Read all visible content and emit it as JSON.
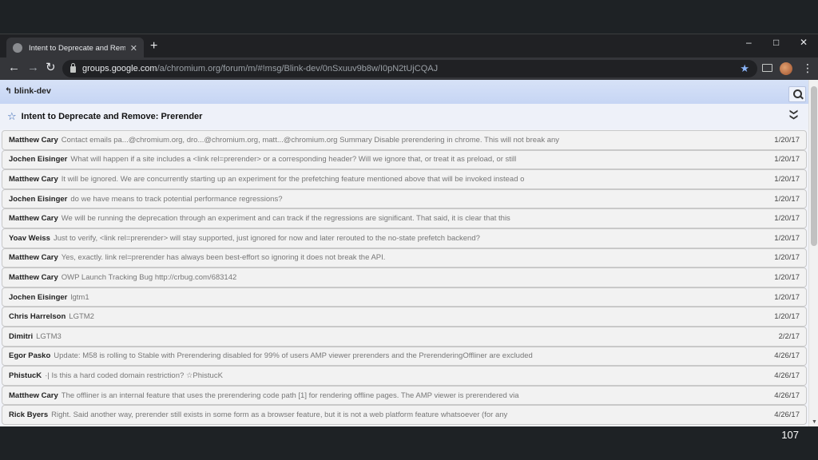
{
  "browser": {
    "tab_title": "Intent to Deprecate and Remove:",
    "new_tab_glyph": "+",
    "window_controls": {
      "minimize": "–",
      "maximize": "□",
      "close": "✕"
    },
    "nav": {
      "back": "←",
      "forward": "→",
      "reload": "↻",
      "menu": "⋮"
    },
    "url_host": "groups.google.com",
    "url_path": "/a/chromium.org/forum/m/#!msg/Blink-dev/0nSxuuv9b8w/I0pN2tUjCQAJ"
  },
  "group": {
    "name": "↰ blink-dev"
  },
  "thread": {
    "title": "Intent to Deprecate and Remove: Prerender"
  },
  "messages": [
    {
      "author": "Matthew Cary",
      "snippet": "Contact emails pa...@chromium.org, dro...@chromium.org, matt...@chromium.org Summary Disable prerendering in chrome. This will not break any",
      "date": "1/20/17"
    },
    {
      "author": "Jochen Eisinger",
      "snippet": "What will happen if a site includes a <link rel=prerender> or a corresponding header? Will we ignore that, or treat it as preload, or still",
      "date": "1/20/17"
    },
    {
      "author": "Matthew Cary",
      "snippet": "It will be ignored. We are concurrently starting up an experiment for the prefetching feature mentioned above that will be invoked instead o",
      "date": "1/20/17"
    },
    {
      "author": "Jochen Eisinger",
      "snippet": "do we have means to track potential performance regressions?",
      "date": "1/20/17"
    },
    {
      "author": "Matthew Cary",
      "snippet": "We will be running the deprecation through an experiment and can track if the regressions are significant. That said, it is clear that this",
      "date": "1/20/17"
    },
    {
      "author": "Yoav Weiss",
      "snippet": "Just to verify, <link rel=prerender> will stay supported, just ignored for now and later rerouted to the no-state prefetch backend?",
      "date": "1/20/17"
    },
    {
      "author": "Matthew Cary",
      "snippet": "Yes, exactly. link rel=prerender has always been best-effort so ignoring it does not break the API.",
      "date": "1/20/17"
    },
    {
      "author": "Matthew Cary",
      "snippet": "OWP Launch Tracking Bug http://crbug.com/683142",
      "date": "1/20/17"
    },
    {
      "author": "Jochen Eisinger",
      "snippet": "lgtm1",
      "date": "1/20/17"
    },
    {
      "author": "Chris Harrelson",
      "snippet": "LGTM2",
      "date": "1/20/17"
    },
    {
      "author": "Dimitri",
      "snippet": "LGTM3",
      "date": "2/2/17"
    },
    {
      "author": "Egor Pasko",
      "snippet": "Update: M58 is rolling to Stable with Prerendering disabled for 99% of users AMP viewer prerenders and the PrerenderingOffliner are excluded",
      "date": "4/26/17"
    },
    {
      "author": "PhistucK",
      "snippet": "·| Is this a hard coded domain restriction? ☆PhistucK",
      "date": "4/26/17"
    },
    {
      "author": "Matthew Cary",
      "snippet": "The offliner is an internal feature that uses the prerendering code path [1] for rendering offline pages. The AMP viewer is prerendered via",
      "date": "4/26/17"
    },
    {
      "author": "Rick Byers",
      "snippet": "Right. Said another way, prerender still exists in some form as a browser feature, but it is not a web platform feature whatsoever (for any",
      "date": "4/26/17"
    }
  ],
  "slide": {
    "page_number": "107"
  }
}
